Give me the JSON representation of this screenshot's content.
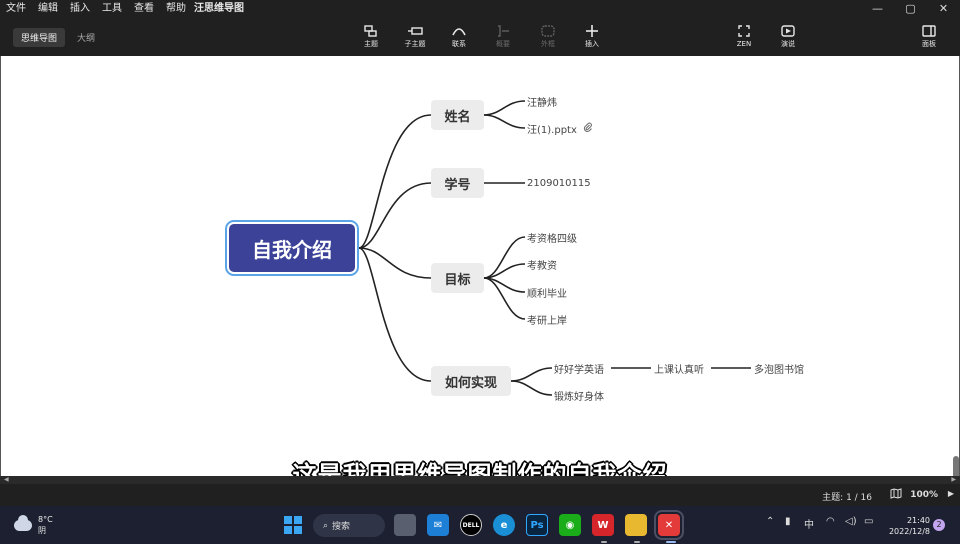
{
  "menu": {
    "items": [
      "文件",
      "编辑",
      "插入",
      "工具",
      "查看",
      "帮助"
    ],
    "app_title": "汪思维导图"
  },
  "window_controls": {
    "minimize": "—",
    "maximize": "▢",
    "close": "✕"
  },
  "toolbar": {
    "view_tabs": [
      "思维导图",
      "大纲"
    ],
    "buttons": [
      {
        "label": "主题",
        "icon": "topic-icon",
        "disabled": false
      },
      {
        "label": "子主题",
        "icon": "subtopic-icon",
        "disabled": false
      },
      {
        "label": "联系",
        "icon": "relationship-icon",
        "disabled": false
      },
      {
        "label": "概要",
        "icon": "summary-icon",
        "disabled": true
      },
      {
        "label": "外框",
        "icon": "boundary-icon",
        "disabled": true
      },
      {
        "label": "插入",
        "icon": "plus-icon",
        "disabled": false
      },
      {
        "label": "ZEN",
        "icon": "zen-icon",
        "disabled": false
      },
      {
        "label": "演说",
        "icon": "pitch-icon",
        "disabled": false
      },
      {
        "label": "面板",
        "icon": "panel-icon",
        "disabled": false
      }
    ]
  },
  "mindmap": {
    "root": "自我介绍",
    "topics": [
      {
        "label": "姓名",
        "children": [
          "汪静炜",
          "汪(1).pptx"
        ]
      },
      {
        "label": "学号",
        "children": [
          "2109010115"
        ]
      },
      {
        "label": "目标",
        "children": [
          "考资格四级",
          "考教资",
          "顺利毕业",
          "考研上岸"
        ]
      },
      {
        "label": "如何实现",
        "children": [
          "好好学英语",
          "锻炼好身体"
        ],
        "chain": [
          "上课认真听",
          "多泡图书馆"
        ]
      }
    ],
    "attachment_icon": "paperclip-icon"
  },
  "subtitle": "这是我用思维导图制作的自我介绍",
  "status": {
    "topic_count": "主题: 1 / 16",
    "zoom": "100%"
  },
  "taskbar": {
    "weather_temp": "8°C",
    "weather_desc": "阴",
    "search_label": "搜索",
    "apps": [
      "start-icon",
      "task-view-icon",
      "mail-icon",
      "dell-icon",
      "edge-icon",
      "photoshop-icon",
      "wechat-icon",
      "wps-icon",
      "folder-icon",
      "xmind-icon"
    ],
    "ime": "中",
    "time": "21:40",
    "date": "2022/12/8",
    "notification_count": "2"
  }
}
